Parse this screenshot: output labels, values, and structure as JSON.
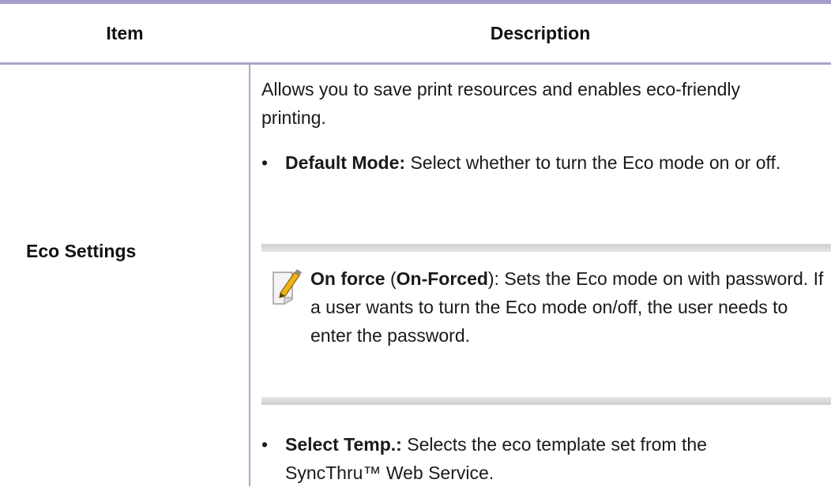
{
  "table": {
    "header": {
      "item": "Item",
      "description": "Description"
    },
    "row": {
      "item": "Eco Settings",
      "intro": "Allows you to save print resources and enables eco-friendly printing.",
      "bullet_char": "•",
      "bullet1": {
        "label": "Default Mode:",
        "text": " Select whether to turn the Eco mode on or off."
      },
      "note": {
        "icon": "note-pencil-icon",
        "label": "On force",
        "paren_open": " (",
        "sublabel": "On-Forced",
        "text": "): Sets the Eco mode on with password. If a user wants to turn the Eco mode on/off, the user needs to enter the password."
      },
      "bullet2": {
        "label": "Select Temp.:",
        "text": " Selects the eco template set from the SyncThru™ Web Service."
      }
    }
  },
  "colors": {
    "rule": "#a39ec9",
    "note_band": "#dcdcdc"
  }
}
